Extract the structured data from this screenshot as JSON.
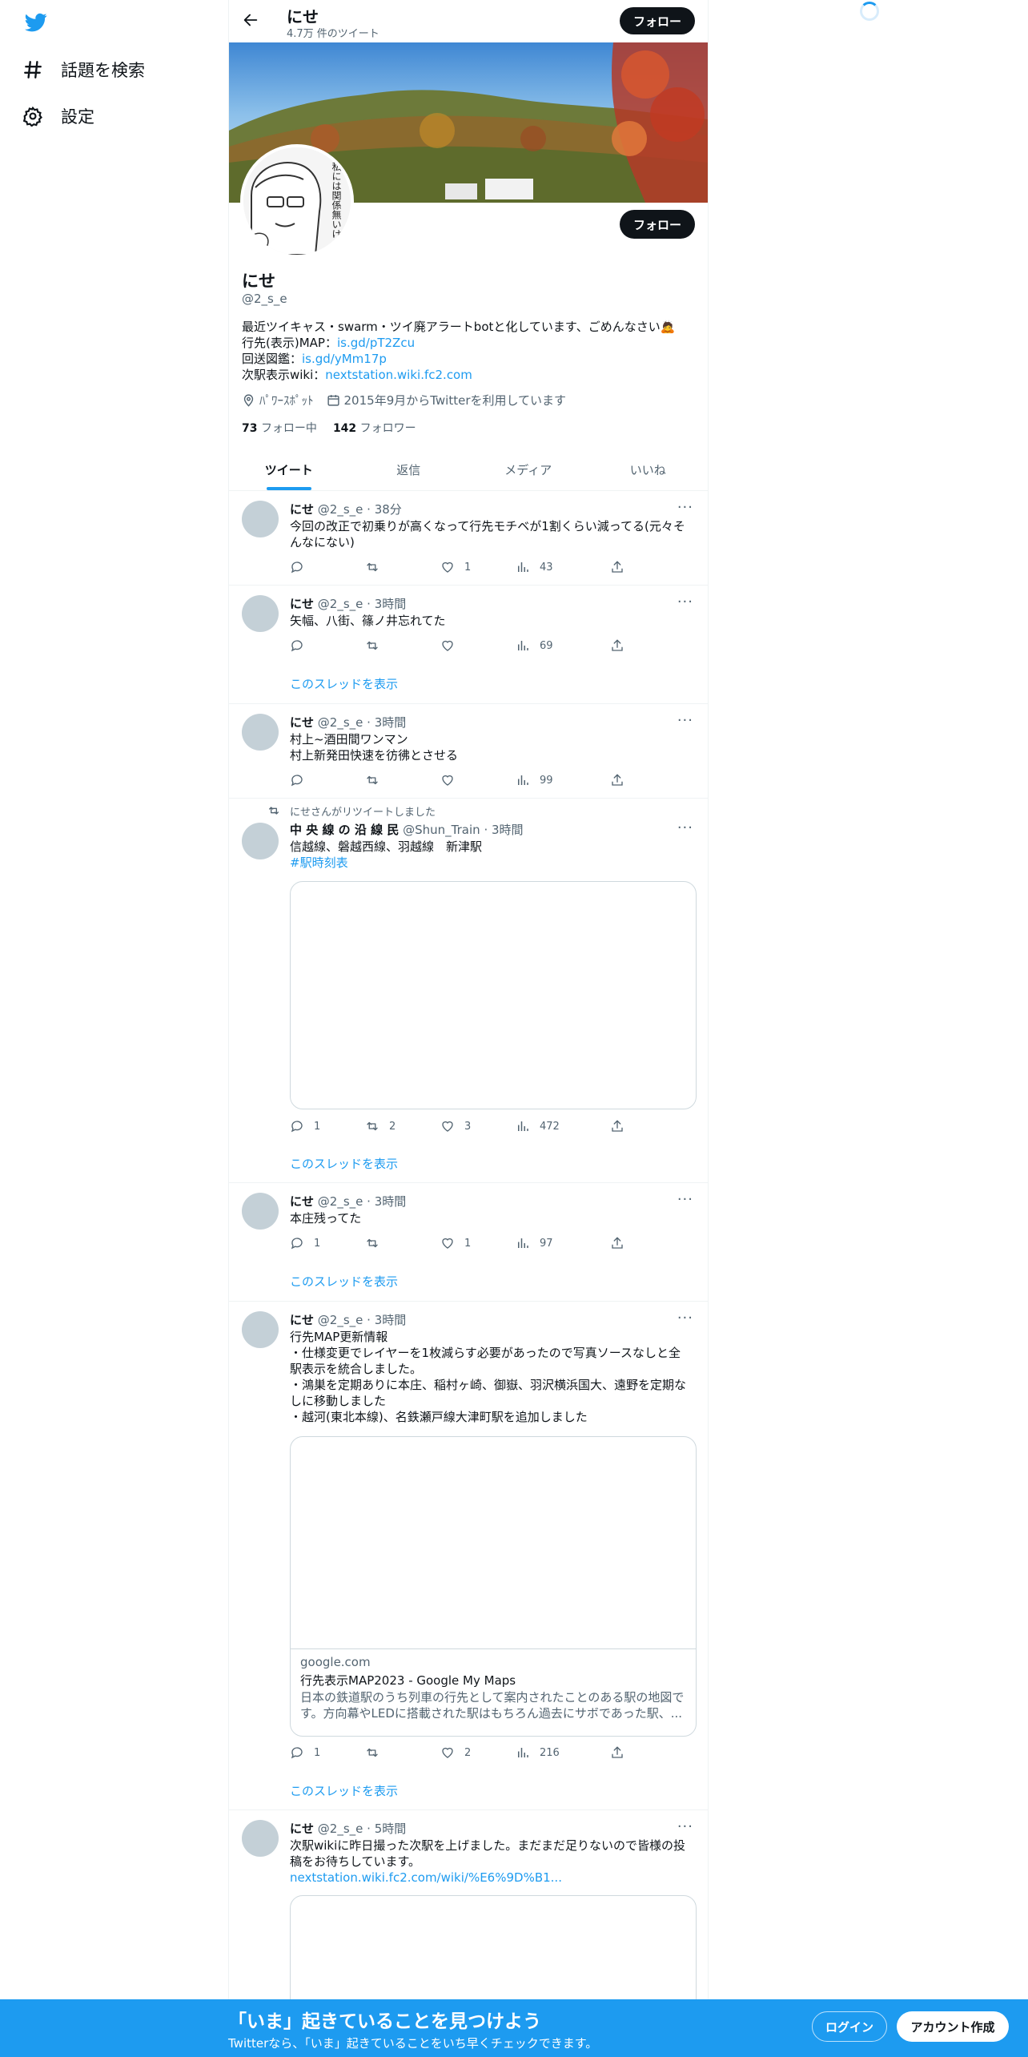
{
  "nav": {
    "logo_icon": "twitter-bird-icon",
    "explore": "話題を検索",
    "settings": "設定"
  },
  "header": {
    "name": "にせ",
    "tweet_count": "4.7万 件のツイート",
    "follow_label": "フォロー"
  },
  "profile": {
    "name": "にせ",
    "handle": "@2_s_e",
    "follow_label": "フォロー",
    "avatar_text": "私には関係無いけど",
    "bio_line1": "最近ツイキャス・swarm・ツイ廃アラートbotと化しています、ごめんなさい🙇",
    "bio_map_label": "行先(表示)MAP：",
    "bio_map_link": "is.gd/pT2Zcu",
    "bio_kaiso_label": "回送図鑑：",
    "bio_kaiso_link": "is.gd/yMm17p",
    "bio_wiki_label": "次駅表示wiki：",
    "bio_wiki_link": "nextstation.wiki.fc2.com",
    "location": "ﾊﾟﾜｰｽﾎﾟｯﾄ",
    "joined": "2015年9月からTwitterを利用しています",
    "following_count": "73",
    "following_label": "フォロー中",
    "followers_count": "142",
    "followers_label": "フォロワー"
  },
  "tabs": [
    "ツイート",
    "返信",
    "メディア",
    "いいね"
  ],
  "tweets": [
    {
      "name": "にせ",
      "handle": "@2_s_e",
      "time": "38分",
      "text": "今回の改正で初乗りが高くなって行先モチベが1割くらい減ってる(元々そんなにない)",
      "reply": "",
      "retweet": "",
      "like": "1",
      "views": "43"
    },
    {
      "name": "にせ",
      "handle": "@2_s_e",
      "time": "3時間",
      "text": "矢幅、八街、篠ノ井忘れてた",
      "reply": "",
      "retweet": "",
      "like": "",
      "views": "69",
      "thread": "このスレッドを表示"
    },
    {
      "name": "にせ",
      "handle": "@2_s_e",
      "time": "3時間",
      "line1": "村上~酒田間ワンマン",
      "line2": "村上新発田快速を彷彿とさせる",
      "reply": "",
      "retweet": "",
      "like": "",
      "views": "99"
    },
    {
      "retweeted_by": "にせさんがリツイートしました",
      "name": "中 央 線 の 沿 線 民",
      "handle": "@Shun_Train",
      "time": "3時間",
      "line1": "信越線、磐越西線、羽越線　新津駅",
      "hashtag": "#駅時刻表",
      "reply": "1",
      "retweet": "2",
      "like": "3",
      "views": "472",
      "thread": "このスレッドを表示"
    },
    {
      "name": "にせ",
      "handle": "@2_s_e",
      "time": "3時間",
      "text": "本庄残ってた",
      "reply": "1",
      "retweet": "",
      "like": "1",
      "views": "97",
      "thread": "このスレッドを表示"
    },
    {
      "name": "にせ",
      "handle": "@2_s_e",
      "time": "3時間",
      "line1": "行先MAP更新情報",
      "line2": "・仕様変更でレイヤーを1枚減らす必要があったので写真ソースなしと全駅表示を統合しました。",
      "line3": "・鴻巣を定期ありに本庄、稲村ヶ崎、御嶽、羽沢横浜国大、遠野を定期なしに移動しました",
      "line4": "・越河(東北本線)、名鉄瀬戸線大津町駅を追加しました",
      "card_domain": "google.com",
      "card_title": "行先表示MAP2023 - Google My Maps",
      "card_desc": "日本の鉄道駅のうち列車の行先として案内されたことのある駅の地図です。方向幕やLEDに搭載された駅はもちろん過去にサボであった駅、...",
      "reply": "1",
      "retweet": "",
      "like": "2",
      "views": "216",
      "thread": "このスレッドを表示"
    },
    {
      "name": "にせ",
      "handle": "@2_s_e",
      "time": "5時間",
      "text": "次駅wikiに昨日撮った次駅を上げました。まだまだ足りないので皆様の投稿をお待ちしています。",
      "link": "nextstation.wiki.fc2.com/wiki/%E6%9D%B1..."
    }
  ],
  "bottom": {
    "title": "「いま」起きていることを見つけよう",
    "subtitle": "Twitterなら、「いま」起きていることをいち早くチェックできます。",
    "login": "ログイン",
    "signup": "アカウント作成"
  },
  "colors": {
    "accent": "#1d9bf0",
    "text": "#0f1419",
    "muted": "#536471"
  }
}
